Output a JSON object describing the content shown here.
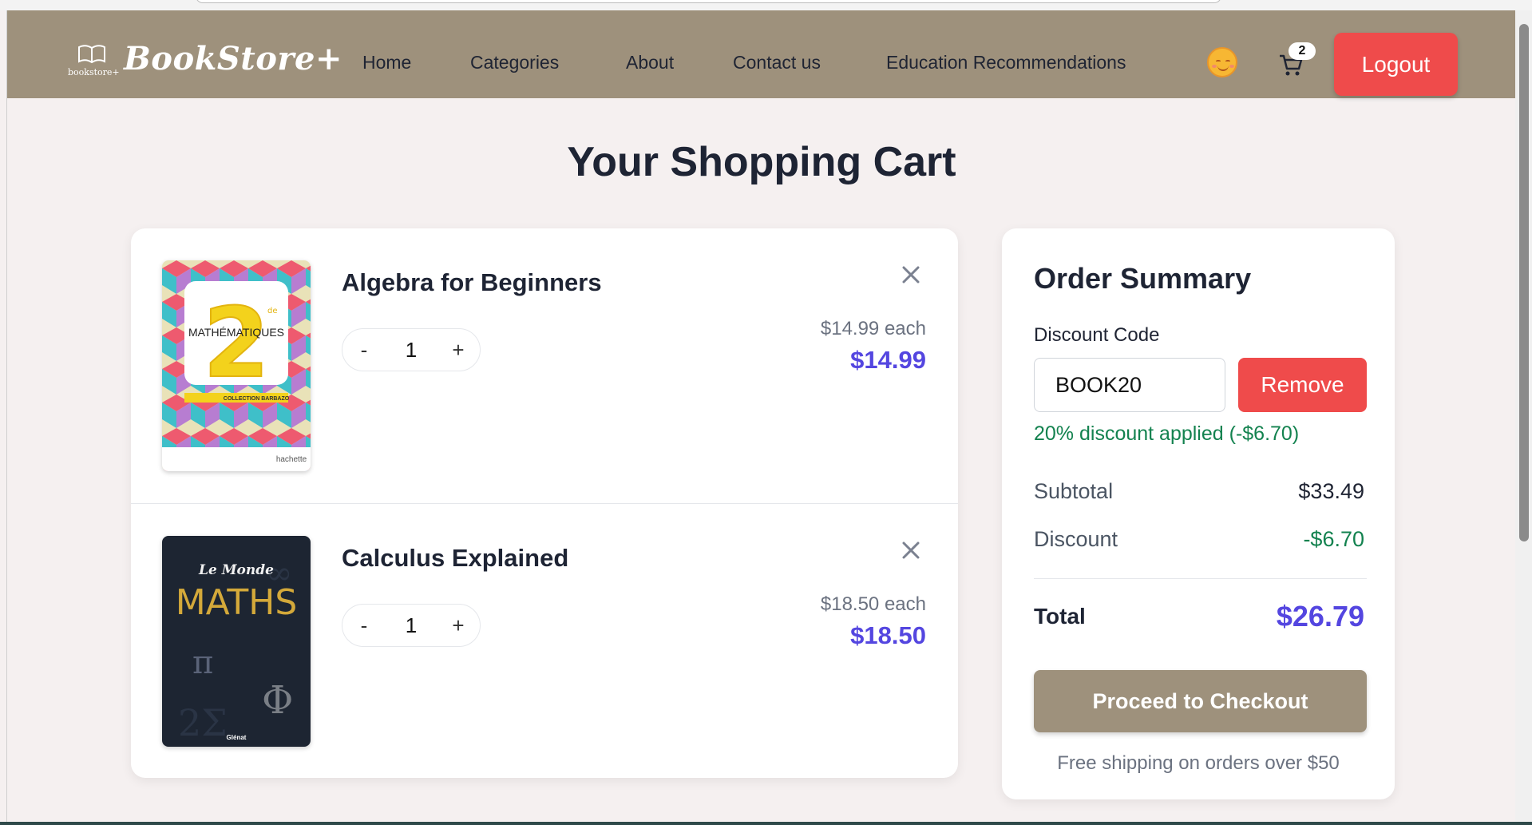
{
  "brand": {
    "small_text": "bookstore+",
    "name": "BookStore+"
  },
  "nav": {
    "links": [
      "Home",
      "Categories",
      "About",
      "Contact us",
      "Education Recommendations"
    ],
    "emoji_icon": "smiling-face-icon",
    "cart_icon": "shopping-cart-icon",
    "cart_count": "2",
    "logout_label": "Logout"
  },
  "page": {
    "title": "Your Shopping Cart"
  },
  "cart": {
    "items": [
      {
        "title": "Algebra for Beginners",
        "quantity": "1",
        "unit_price": "$14.99 each",
        "line_total": "$14.99",
        "cover": {
          "title": "MATHÉMATIQUES",
          "grade": "2",
          "grade_suffix": "de",
          "collection": "COLLECTION BARBAZO",
          "publisher": "hachette"
        }
      },
      {
        "title": "Calculus Explained",
        "quantity": "1",
        "unit_price": "$18.50 each",
        "line_total": "$18.50",
        "cover": {
          "brand": "Le Monde",
          "title": "MATHS",
          "publisher": "Glénat"
        }
      }
    ],
    "decrement_label": "-",
    "increment_label": "+"
  },
  "summary": {
    "title": "Order Summary",
    "discount_label": "Discount Code",
    "discount_code": "BOOK20",
    "remove_label": "Remove",
    "discount_message": "20% discount applied (-$6.70)",
    "subtotal_label": "Subtotal",
    "subtotal_value": "$33.49",
    "discount_row_label": "Discount",
    "discount_row_value": "-$6.70",
    "total_label": "Total",
    "total_value": "$26.79",
    "checkout_label": "Proceed to Checkout",
    "shipping_note": "Free shipping on orders over $50"
  },
  "colors": {
    "navbar": "#9e917c",
    "accent_price": "#5446e0",
    "danger": "#ef4b4b",
    "success": "#13824f",
    "page_bg": "#f5f0f0"
  }
}
